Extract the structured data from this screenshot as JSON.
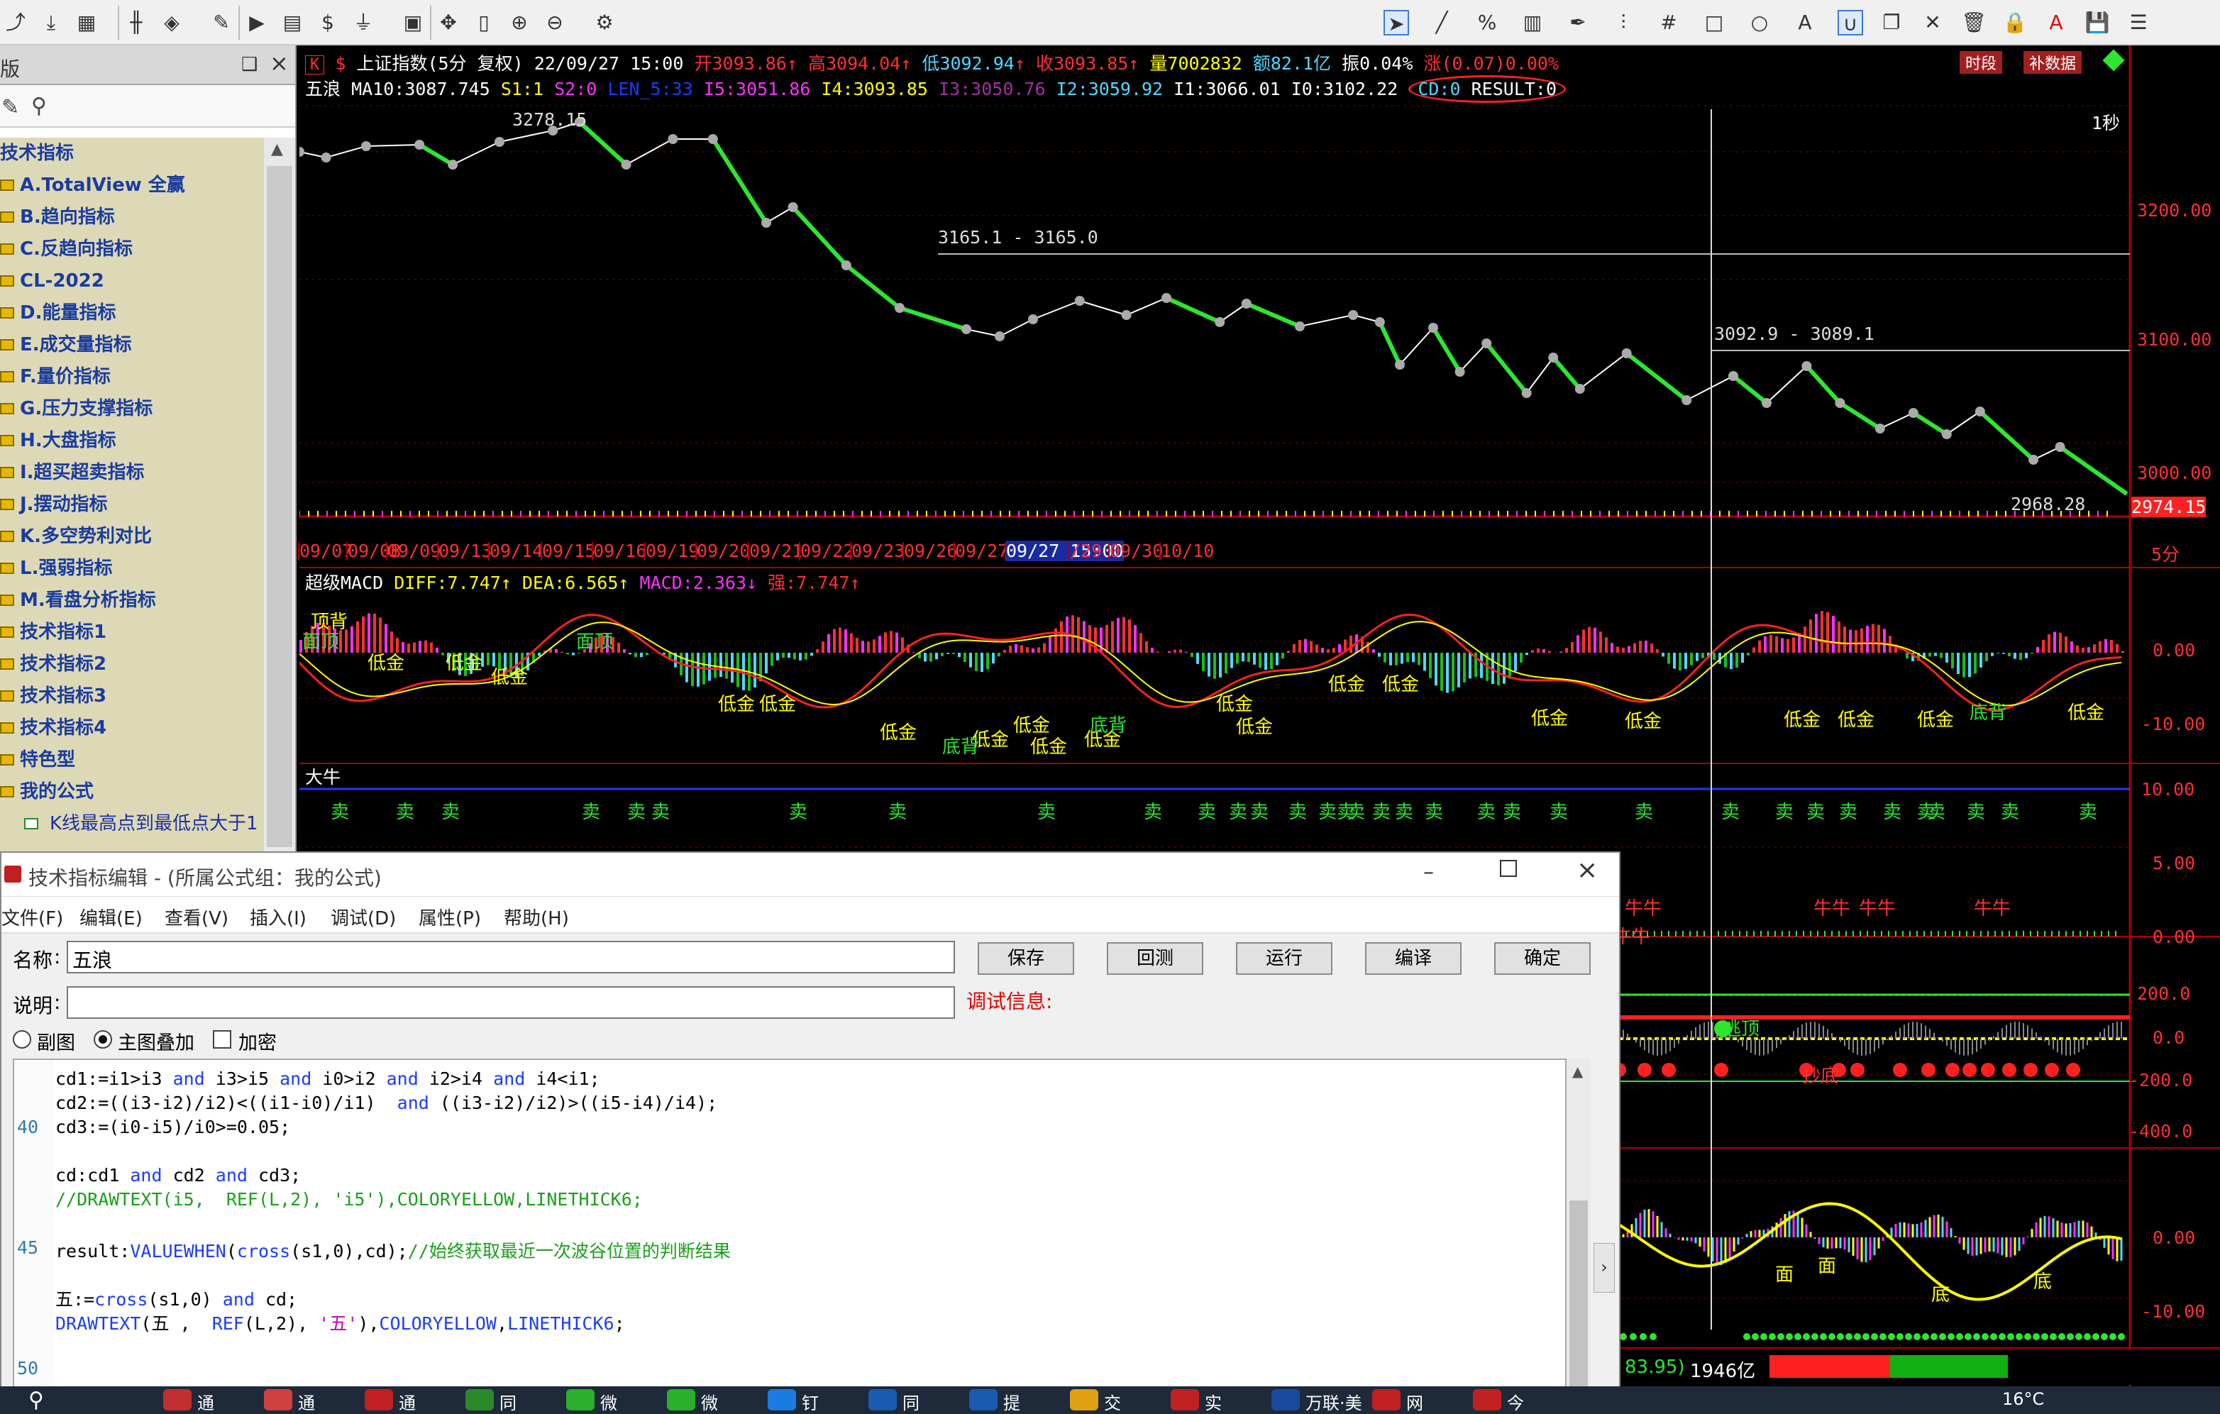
{
  "toolbar": {
    "left_icons": [
      "arrow-icon",
      "download-icon",
      "grid-icon",
      "candle-icon",
      "diamond-icon",
      "edit-icon",
      "play-icon",
      "note-icon",
      "dollar-icon",
      "filter-icon",
      "panel-icon",
      "move-icon",
      "bar-icon",
      "zoom-in-icon",
      "zoom-out-icon",
      "gear-icon"
    ],
    "right_icons": [
      "cursor-icon",
      "line-icon",
      "percent-icon",
      "table-icon",
      "pen-icon",
      "align-icon",
      "hash-icon",
      "rect-icon",
      "circle-icon",
      "text-icon",
      "magnet-icon",
      "copy-icon",
      "close-icon",
      "trash-icon",
      "lock-icon",
      "font-color-icon",
      "save-icon",
      "more-icon"
    ]
  },
  "sidebar": {
    "header_title": "版",
    "pin": "❑",
    "close": "×",
    "items": [
      {
        "label": "技术指标",
        "folder": false
      },
      {
        "label": "A.TotalView 全赢",
        "folder": true
      },
      {
        "label": "B.趋向指标",
        "folder": true
      },
      {
        "label": "C.反趋向指标",
        "folder": true
      },
      {
        "label": "CL-2022",
        "folder": true
      },
      {
        "label": "D.能量指标",
        "folder": true
      },
      {
        "label": "E.成交量指标",
        "folder": true
      },
      {
        "label": "F.量价指标",
        "folder": true
      },
      {
        "label": "G.压力支撑指标",
        "folder": true
      },
      {
        "label": "H.大盘指标",
        "folder": true
      },
      {
        "label": "I.超买超卖指标",
        "folder": true
      },
      {
        "label": "J.摆动指标",
        "folder": true
      },
      {
        "label": "K.多空势利对比",
        "folder": true
      },
      {
        "label": "L.强弱指标",
        "folder": true
      },
      {
        "label": "M.看盘分析指标",
        "folder": true
      },
      {
        "label": "技术指标1",
        "folder": true
      },
      {
        "label": "技术指标2",
        "folder": true
      },
      {
        "label": "技术指标3",
        "folder": true
      },
      {
        "label": "技术指标4",
        "folder": true
      },
      {
        "label": "特色型",
        "folder": true
      },
      {
        "label": "我的公式",
        "folder": true
      },
      {
        "label": "K线最高点到最低点大于1",
        "folder": false
      }
    ]
  },
  "chart": {
    "title_tag": "K",
    "title_dollar": "$",
    "title": "上证指数(5分 复权) 22/09/27 15:00",
    "open": "开3093.86",
    "high": "高3094.04",
    "low": "低3092.94",
    "close": "收3093.85",
    "volume": "量7002832",
    "amount": "额82.1亿",
    "amplitude": "振0.04%",
    "change": "涨(0.07)0.00%",
    "btn_time": "时段",
    "btn_fill": "补数据",
    "indicator_line": {
      "name": "五浪",
      "ma10": "MA10:3087.745",
      "s1": "S1:1",
      "s2": "S2:0",
      "len5": "LEN_5:33",
      "i5": "I5:3051.86",
      "i4": "I4:3093.85",
      "i3": "I3:3050.76",
      "i2": "I2:3059.92",
      "i1": "I1:3066.01",
      "i0": "I0:3102.22",
      "cd": "CD:0",
      "result": "RESULT:0"
    },
    "period_label": "1秒",
    "level1": "3165.1 - 3165.0",
    "level2": "3092.9 - 3089.1",
    "peak_label": "3278.15",
    "low_label": "2968.28",
    "price_axis": [
      "3200.00",
      "3100.00",
      "3000.00"
    ],
    "current_price": "2974.15",
    "dates": [
      "09/07",
      "09/08",
      "09/09",
      "09/13",
      "09/14",
      "09/15",
      "09/16",
      "09/19",
      "09/20",
      "09/21",
      "09/22",
      "09/23",
      "09/26",
      "09/27",
      "09/27 15:00",
      "/29",
      "09/30",
      "10/10"
    ],
    "interval": "5分",
    "macd": {
      "name": "超级MACD",
      "diff": "DIFF:7.747",
      "dea": "DEA:6.565",
      "macd": "MACD:2.363",
      "strong": "强:7.747",
      "axis": [
        "0.00",
        "-10.00"
      ],
      "labels": [
        "顶背",
        "面顶",
        "低金",
        "低金",
        "低金",
        "面顶",
        "低金",
        "低金",
        "低金",
        "低金",
        "底背",
        "低金",
        "低金",
        "低金",
        "底背",
        "低金",
        "低金",
        "低金",
        "低金",
        "低金",
        "低金",
        "低金",
        "低金",
        "低金",
        "底背",
        "低金"
      ]
    },
    "daniu": {
      "name": "大牛",
      "axis": [
        "10.00",
        "5.00",
        "0.00"
      ],
      "sell": "卖",
      "niu_labels": [
        "牛牛",
        "牛牛",
        "牛牛",
        "牛牛",
        "牛牛"
      ]
    },
    "panel4": {
      "axis": [
        "200.0",
        "0.0",
        "-200.0",
        "-400.0"
      ],
      "labels": [
        "逃顶",
        "彭底",
        "抄底"
      ]
    },
    "panel5": {
      "axis": [
        "0.00",
        "-10.00"
      ],
      "labels": [
        "面",
        "面",
        "底",
        "底"
      ]
    },
    "status": {
      "value": "83.95)",
      "amount": "1946亿"
    }
  },
  "dialog": {
    "title": "技术指标编辑 - (所属公式组：我的公式)",
    "menu": [
      "文件(F)",
      "编辑(E)",
      "查看(V)",
      "插入(I)",
      "调试(D)",
      "属性(P)",
      "帮助(H)"
    ],
    "name_label": "名称",
    "name_value": "五浪",
    "desc_label": "说明",
    "desc_value": "",
    "debug_label": "调试信息:",
    "buttons": [
      "保存",
      "回测",
      "运行",
      "编译",
      "确定"
    ],
    "radio": [
      "副图",
      "主图叠加"
    ],
    "checkbox": "加密",
    "code": [
      {
        "ln": "",
        "text": "cd1:=i1>i3 and i3>i5 and i0>i2 and i2>i4 and i4<i1;"
      },
      {
        "ln": "",
        "text": "cd2:=((i3-i2)/i2)<((i1-i0)/i1)  and ((i3-i2)/i2)>((i5-i4)/i4);"
      },
      {
        "ln": "40",
        "text": "cd3:=(i0-i5)/i0>=0.05;"
      },
      {
        "ln": "",
        "text": ""
      },
      {
        "ln": "",
        "text": "cd:cd1 and cd2 and cd3;"
      },
      {
        "ln": "",
        "text": "//DRAWTEXT(i5,  REF(L,2), 'i5'),COLORYELLOW,LINETHICK6;"
      },
      {
        "ln": "",
        "text": ""
      },
      {
        "ln": "45",
        "text": "result:VALUEWHEN(cross(s1,0),cd);//始终获取最近一次波谷位置的判断结果"
      },
      {
        "ln": "",
        "text": ""
      },
      {
        "ln": "",
        "text": "五:=cross(s1,0) and cd;"
      },
      {
        "ln": "",
        "text": "DRAWTEXT(五 ,  REF(L,2), '五'),COLORYELLOW,LINETHICK6;"
      },
      {
        "ln": "",
        "text": ""
      },
      {
        "ln": "50",
        "text": ""
      }
    ]
  },
  "taskbar": {
    "items": [
      "通",
      "通",
      "通",
      "同",
      "微",
      "微",
      "钉",
      "同",
      "提",
      "交",
      "实",
      "万联·美",
      "网",
      "今"
    ],
    "weather": "16°C"
  }
}
